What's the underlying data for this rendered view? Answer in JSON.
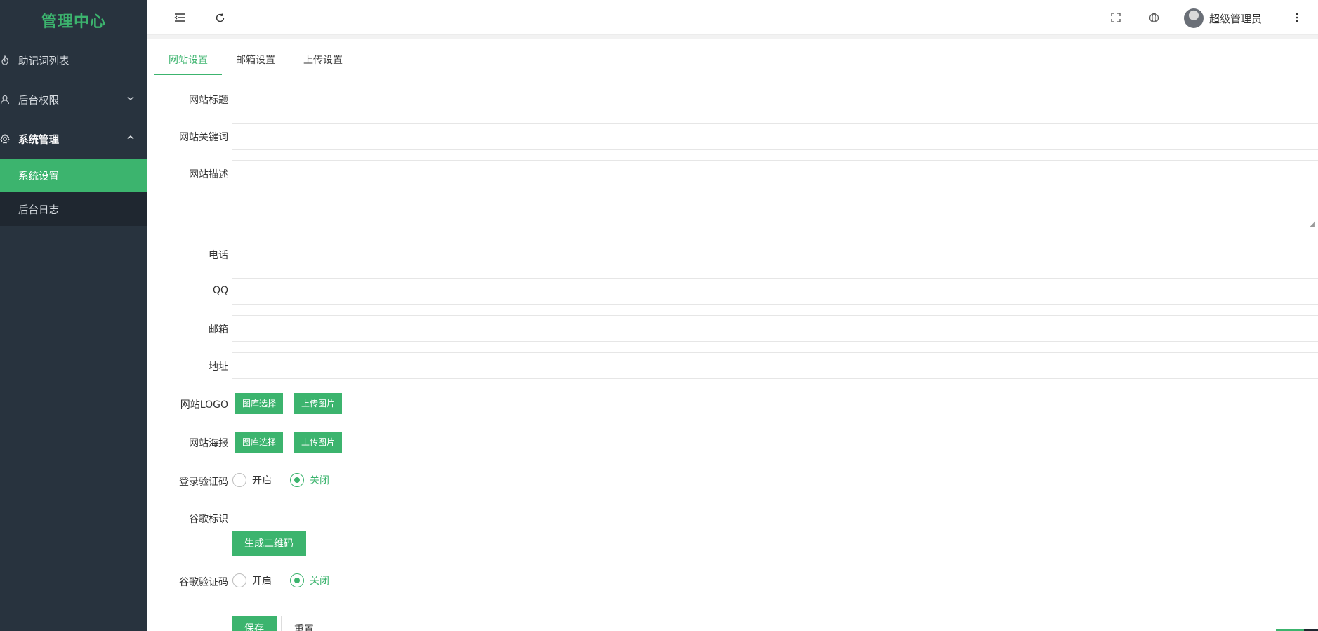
{
  "brand": "管理中心",
  "sidebar": {
    "items": [
      {
        "label": "助记词列表",
        "icon": "fire-icon"
      },
      {
        "label": "后台权限",
        "icon": "user-icon"
      },
      {
        "label": "系统管理",
        "icon": "gear-icon"
      }
    ],
    "sub_items": [
      {
        "label": "系统设置",
        "active": true
      },
      {
        "label": "后台日志",
        "active": false
      }
    ]
  },
  "topbar": {
    "user_name": "超级管理员"
  },
  "tabs": [
    {
      "label": "网站设置",
      "active": true
    },
    {
      "label": "邮箱设置",
      "active": false
    },
    {
      "label": "上传设置",
      "active": false
    }
  ],
  "form": {
    "site_title": {
      "label": "网站标题",
      "value": ""
    },
    "site_keywords": {
      "label": "网站关键词",
      "value": ""
    },
    "site_desc": {
      "label": "网站描述",
      "value": ""
    },
    "phone": {
      "label": "电话",
      "value": ""
    },
    "qq": {
      "label": "QQ",
      "value": ""
    },
    "email": {
      "label": "邮箱",
      "value": ""
    },
    "address": {
      "label": "地址",
      "value": ""
    },
    "logo": {
      "label": "网站LOGO",
      "btn_gallery": "图库选择",
      "btn_upload": "上传图片"
    },
    "poster": {
      "label": "网站海报",
      "btn_gallery": "图库选择",
      "btn_upload": "上传图片"
    },
    "login_captcha": {
      "label": "登录验证码",
      "opt_on": "开启",
      "opt_off": "关闭",
      "selected": "关闭"
    },
    "google_id": {
      "label": "谷歌标识",
      "value": "",
      "btn_generate": "生成二维码"
    },
    "google_captcha": {
      "label": "谷歌验证码",
      "opt_on": "开启",
      "opt_off": "关闭",
      "selected": "关闭"
    },
    "save_label": "保存",
    "reset_label": "重置"
  },
  "colors": {
    "accent": "#3cb46e",
    "sidebar_bg": "#28333e",
    "submenu_bg": "#1f2730"
  }
}
